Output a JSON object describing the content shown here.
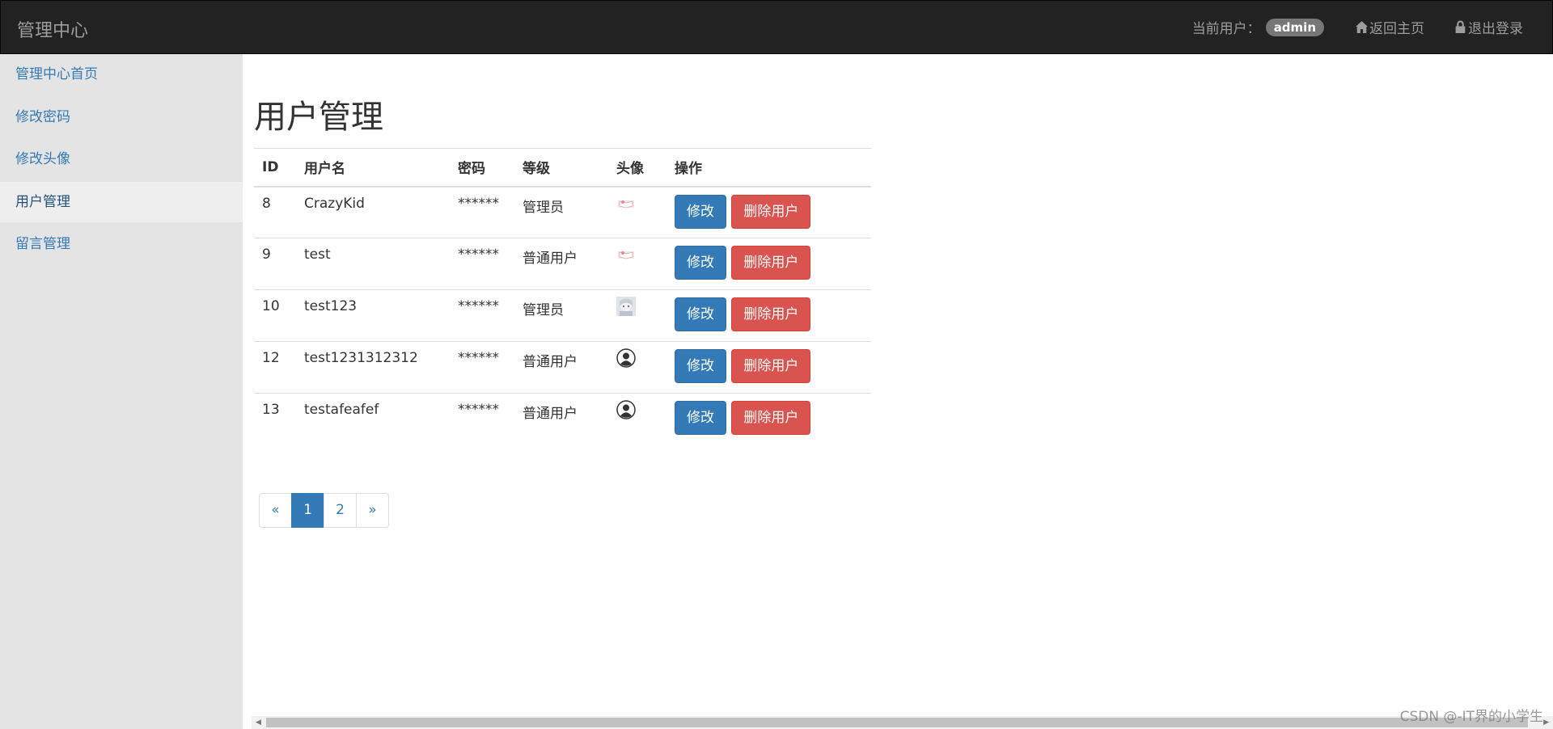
{
  "navbar": {
    "brand": "管理中心",
    "current_user_label": "当前用户：",
    "current_user": "admin",
    "home_link": "返回主页",
    "logout_link": "退出登录"
  },
  "sidebar": {
    "items": [
      {
        "label": "管理中心首页",
        "active": false
      },
      {
        "label": "修改密码",
        "active": false
      },
      {
        "label": "修改头像",
        "active": false
      },
      {
        "label": "用户管理",
        "active": true
      },
      {
        "label": "留言管理",
        "active": false
      }
    ]
  },
  "main": {
    "title": "用户管理",
    "table": {
      "headers": [
        "ID",
        "用户名",
        "密码",
        "等级",
        "头像",
        "操作"
      ],
      "rows": [
        {
          "id": "8",
          "username": "CrazyKid",
          "password": "******",
          "level": "管理员",
          "avatar": "book-avatar-icon"
        },
        {
          "id": "9",
          "username": "test",
          "password": "******",
          "level": "普通用户",
          "avatar": "book-avatar-icon"
        },
        {
          "id": "10",
          "username": "test123",
          "password": "******",
          "level": "管理员",
          "avatar": "anime-avatar-icon"
        },
        {
          "id": "12",
          "username": "test1231312312",
          "password": "******",
          "level": "普通用户",
          "avatar": "default-user-avatar-icon"
        },
        {
          "id": "13",
          "username": "testafeafef",
          "password": "******",
          "level": "普通用户",
          "avatar": "default-user-avatar-icon"
        }
      ],
      "edit_label": "修改",
      "delete_label": "删除用户"
    },
    "pagination": {
      "prev": "«",
      "pages": [
        "1",
        "2"
      ],
      "current": "1",
      "next": "»"
    }
  },
  "watermark": "CSDN @-IT界的小学生",
  "colors": {
    "navbar_bg": "#222222",
    "sidebar_bg": "#e4e4e4",
    "link": "#337ab7",
    "primary": "#337ab7",
    "danger": "#d9534f",
    "badge": "#777777"
  }
}
